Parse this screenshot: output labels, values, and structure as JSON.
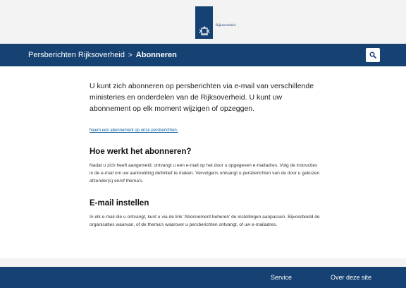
{
  "header": {
    "logo_text": "Rijksoverheid"
  },
  "nav": {
    "breadcrumb_parent": "Persberichten Rijksoverheid",
    "breadcrumb_separator": ">",
    "breadcrumb_current": "Abonneren",
    "search_icon": "search-icon"
  },
  "main": {
    "intro": "U kunt zich abonneren op persberichten via e-mail van verschillende ministeries en onderdelen van de Rijksoverheid. U kunt uw abonnement op elk moment wijzigen of opzeggen.",
    "subscribe_link": "Neem een abonnement op onze persberichten.",
    "section1_title": "Hoe werkt het abonneren?",
    "section1_text": "Nadat u zich heeft aangemeld, ontvangt u een e-mail op het door u opgegeven e-mailadres. Volg de instructies in de e-mail om uw aanmelding definitief te maken. Vervolgens ontvangt u persberichten van de door u gekozen afzender(s) en/of thema's.",
    "section2_title": "E-mail instellen",
    "section2_text": "In elk e-mail die u ontvangt, kunt u via de link 'Abonnement beheren' de instellingen aanpassen. Bijvoorbeeld de organisaties waarvan, of de thema's waarover u persberichten ontvangt, of uw e-mailadres."
  },
  "footer": {
    "service": "Service",
    "over": "Over deze site"
  },
  "colors": {
    "brand_blue": "#154273",
    "link_blue": "#0b5ea0",
    "background_grey": "#f3f3f3"
  }
}
